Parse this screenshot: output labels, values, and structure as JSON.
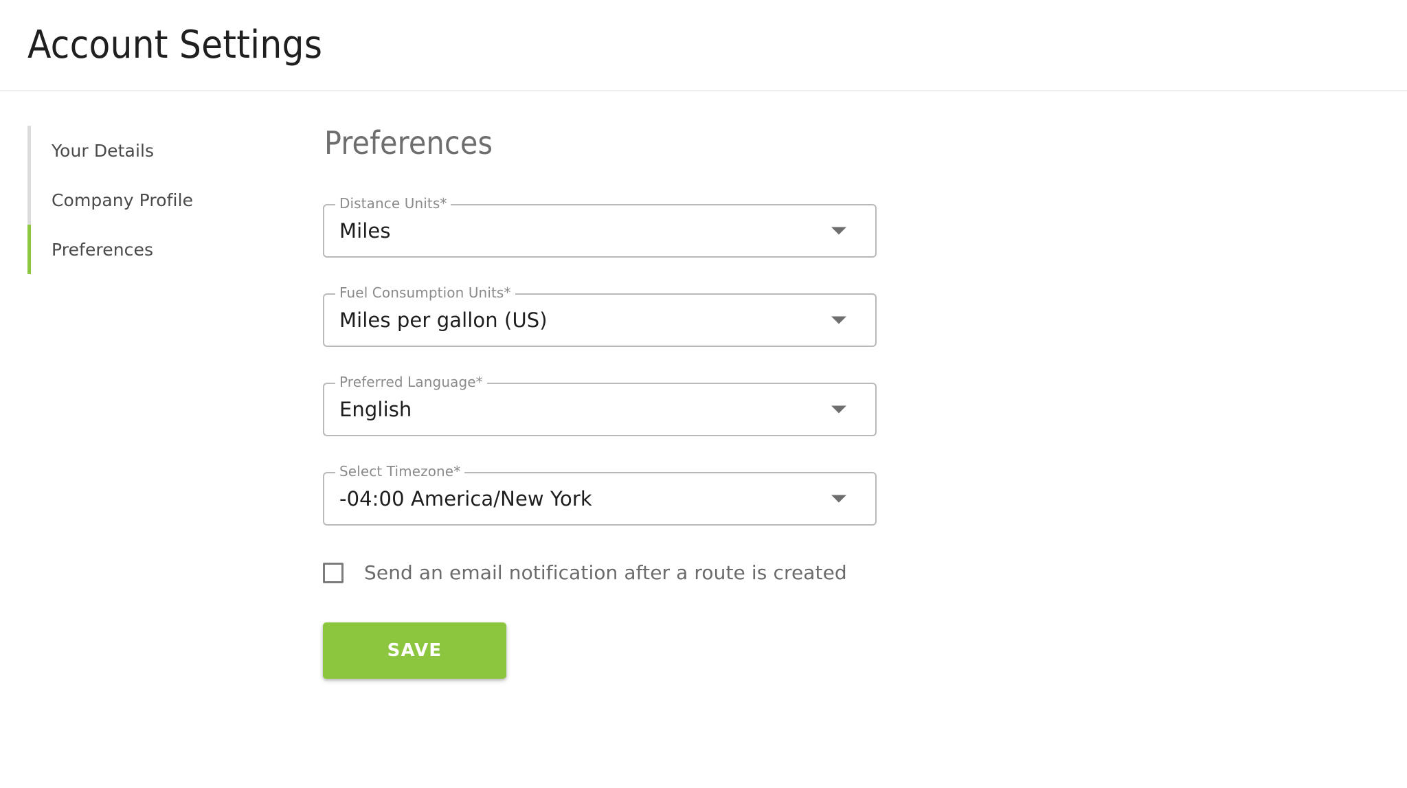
{
  "header": {
    "title": "Account Settings"
  },
  "sidebar": {
    "items": [
      {
        "label": "Your Details",
        "active": false
      },
      {
        "label": "Company Profile",
        "active": false
      },
      {
        "label": "Preferences",
        "active": true
      }
    ]
  },
  "main": {
    "section_title": "Preferences",
    "fields": [
      {
        "label": "Distance Units*",
        "value": "Miles",
        "icon": "chevron-down-icon"
      },
      {
        "label": "Fuel Consumption Units*",
        "value": "Miles per gallon (US)",
        "icon": "chevron-down-icon"
      },
      {
        "label": "Preferred Language*",
        "value": "English",
        "icon": "chevron-down-icon"
      },
      {
        "label": "Select Timezone*",
        "value": "-04:00 America/New York",
        "icon": "chevron-down-icon"
      }
    ],
    "checkbox": {
      "label": "Send an email notification after a route is created",
      "checked": false
    },
    "save_label": "SAVE"
  },
  "colors": {
    "accent_green": "#8cc63e",
    "outline_gray": "#b9b9b9",
    "label_gray": "#8a8a8a",
    "divider": "#efeff0"
  }
}
